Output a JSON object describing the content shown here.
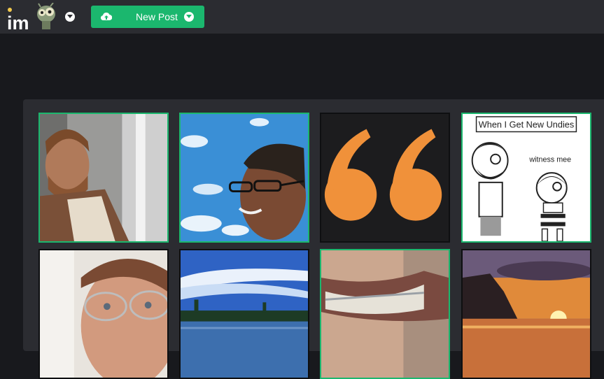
{
  "header": {
    "logo_alt": "imgur",
    "new_post_label": "New Post",
    "upload_icon": "cloud-upload-icon",
    "dropdown_icon": "chevron-down-icon",
    "accent_color": "#1bb76e"
  },
  "gallery": {
    "tiles": [
      {
        "name": "bearded-man-robe",
        "highlighted": true
      },
      {
        "name": "man-glasses-sky",
        "highlighted": true
      },
      {
        "name": "orange-quote-marks",
        "highlighted": false
      },
      {
        "name": "comic-new-undies",
        "highlighted": true,
        "caption": "When I Get New Undies",
        "speech": "witness mee"
      },
      {
        "name": "man-glasses-closeup",
        "highlighted": false
      },
      {
        "name": "lake-blue-sky",
        "highlighted": false
      },
      {
        "name": "braces-smile",
        "highlighted": true
      },
      {
        "name": "sunset-coast",
        "highlighted": false
      }
    ]
  }
}
